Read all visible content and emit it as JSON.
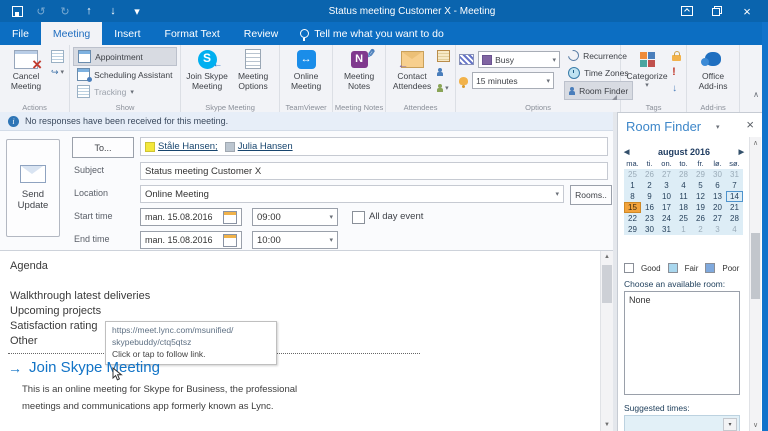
{
  "window": {
    "title": "Status meeting Customer X - Meeting"
  },
  "icons": {
    "undo": "↺",
    "redo": "↻",
    "move_up": "↑",
    "move_down": "↓",
    "qat_customize": "▾",
    "close": "×",
    "dropdown": "▾",
    "skype_s": "S",
    "teamviewer_arrows": "↔",
    "onenote_n": "N",
    "forward": "↪",
    "exclamation": "!",
    "low_importance": "↓",
    "info_i": "i",
    "cal_prev": "◀",
    "cal_next": "▶",
    "collapse_ribbon": "∧",
    "scroll_up": "▲",
    "scroll_down": "▼",
    "panel_scroll_up": "∧",
    "panel_scroll_down": "∨",
    "join_arrow": "→"
  },
  "tabs": {
    "items": [
      {
        "label": "File",
        "active": false
      },
      {
        "label": "Meeting",
        "active": true
      },
      {
        "label": "Insert",
        "active": false
      },
      {
        "label": "Format Text",
        "active": false
      },
      {
        "label": "Review",
        "active": false
      }
    ],
    "tellme": "Tell me what you want to do"
  },
  "ribbon": {
    "actions": {
      "cancel": "Cancel\nMeeting",
      "label": "Actions"
    },
    "show": {
      "appointment": "Appointment",
      "scheduling": "Scheduling Assistant",
      "tracking": "Tracking",
      "label": "Show"
    },
    "skype": {
      "join": "Join Skype\nMeeting",
      "options": "Meeting\nOptions",
      "label": "Skype Meeting"
    },
    "teamviewer": {
      "online": "Online\nMeeting",
      "label": "TeamViewer"
    },
    "notes": {
      "notes": "Meeting\nNotes",
      "label": "Meeting Notes"
    },
    "attendees": {
      "contact": "Contact\nAttendees",
      "label": "Attendees"
    },
    "options": {
      "busy": "Busy",
      "reminder": "15 minutes",
      "recurrence": "Recurrence",
      "timezones": "Time Zones",
      "roomfinder": "Room Finder",
      "label": "Options"
    },
    "tags": {
      "categorize": "Categorize",
      "label": "Tags"
    },
    "addins": {
      "office": "Office\nAdd-ins",
      "label": "Add-ins"
    }
  },
  "infobar": {
    "text": "No responses have been received for this meeting."
  },
  "form": {
    "send_update": "Send\nUpdate",
    "to_button": "To...",
    "recipients": [
      {
        "name": "Ståle Hansen;",
        "chip_color": "#f3e73c"
      },
      {
        "name": "Julia Hansen",
        "chip_color": "#bcc6d0"
      }
    ],
    "labels": {
      "subject": "Subject",
      "location": "Location",
      "start": "Start time",
      "end": "End time"
    },
    "subject_value": "Status meeting Customer X",
    "location_value": "Online Meeting",
    "rooms_button": "Rooms..",
    "start_date": "man. 15.08.2016",
    "start_time": "09:00",
    "end_date": "man. 15.08.2016",
    "end_time": "10:00",
    "allday_label": "All day event"
  },
  "body": {
    "lines": [
      "Agenda",
      "",
      "Walkthrough latest deliveries",
      "Upcoming projects",
      "Satisfaction rating",
      "Other"
    ],
    "tooltip": {
      "line1": "https://meet.lync.com/msunified/",
      "line2": "skypebuddy/ctq5qtsz",
      "line3": "Click or tap to follow link."
    },
    "join_link": "Join Skype Meeting",
    "description": [
      "This is an online meeting for Skype for Business, the professional",
      "meetings and communications app formerly known as Lync."
    ]
  },
  "room_finder": {
    "title": "Room Finder",
    "calendar": {
      "month": "august 2016",
      "day_headers": [
        "ma.",
        "ti.",
        "on.",
        "to.",
        "fr.",
        "lø.",
        "sø."
      ],
      "weeks": [
        [
          {
            "t": "25",
            "s": "m"
          },
          {
            "t": "26",
            "s": "m"
          },
          {
            "t": "27",
            "s": "m"
          },
          {
            "t": "28",
            "s": "m"
          },
          {
            "t": "29",
            "s": "m"
          },
          {
            "t": "30",
            "s": "m"
          },
          {
            "t": "31",
            "s": "m"
          }
        ],
        [
          {
            "t": "1"
          },
          {
            "t": "2"
          },
          {
            "t": "3"
          },
          {
            "t": "4"
          },
          {
            "t": "5"
          },
          {
            "t": "6"
          },
          {
            "t": "7"
          }
        ],
        [
          {
            "t": "8"
          },
          {
            "t": "9"
          },
          {
            "t": "10"
          },
          {
            "t": "11"
          },
          {
            "t": "12"
          },
          {
            "t": "13"
          },
          {
            "t": "14",
            "s": "t"
          }
        ],
        [
          {
            "t": "15",
            "s": "sel"
          },
          {
            "t": "16"
          },
          {
            "t": "17"
          },
          {
            "t": "18"
          },
          {
            "t": "19"
          },
          {
            "t": "20"
          },
          {
            "t": "21"
          }
        ],
        [
          {
            "t": "22"
          },
          {
            "t": "23"
          },
          {
            "t": "24"
          },
          {
            "t": "25"
          },
          {
            "t": "26"
          },
          {
            "t": "27"
          },
          {
            "t": "28"
          }
        ],
        [
          {
            "t": "29"
          },
          {
            "t": "30"
          },
          {
            "t": "31"
          },
          {
            "t": "1",
            "s": "m"
          },
          {
            "t": "2",
            "s": "m"
          },
          {
            "t": "3",
            "s": "m"
          },
          {
            "t": "4",
            "s": "m"
          }
        ]
      ]
    },
    "legend": [
      {
        "label": "Good",
        "color": "#ffffff"
      },
      {
        "label": "Fair",
        "color": "#a9d7ee"
      },
      {
        "label": "Poor",
        "color": "#7fa9dd"
      }
    ],
    "choose_label": "Choose an available room:",
    "rooms": [
      "None"
    ],
    "suggested_label": "Suggested times:"
  }
}
